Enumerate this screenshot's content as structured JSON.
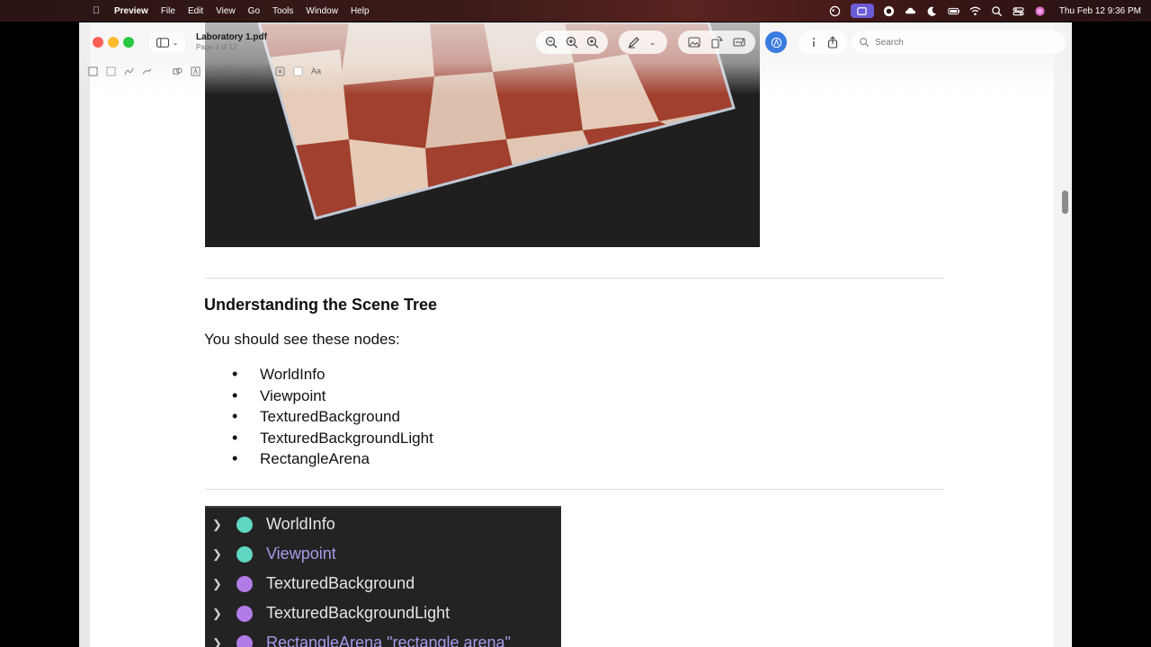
{
  "menubar": {
    "app_name": "Preview",
    "items": [
      "File",
      "Edit",
      "View",
      "Go",
      "Tools",
      "Window",
      "Help"
    ],
    "clock": "Thu Feb 12  9:36 PM"
  },
  "window": {
    "title": "Laboratory 1.pdf",
    "subtitle": "Page 3 of 12",
    "search_placeholder": "Search"
  },
  "document": {
    "heading": "Understanding the Scene Tree",
    "intro": "You should see these nodes:",
    "bullets": [
      "WorldInfo",
      "Viewpoint",
      "TexturedBackground",
      "TexturedBackgroundLight",
      "RectangleArena"
    ],
    "tree_items": [
      {
        "label": "WorldInfo",
        "dot_color": "#5fd6bf",
        "text_color": "#e6e6e6"
      },
      {
        "label": "Viewpoint",
        "dot_color": "#5fd6bf",
        "text_color": "#a59bea"
      },
      {
        "label": "TexturedBackground",
        "dot_color": "#b27be8",
        "text_color": "#e6e6e6"
      },
      {
        "label": "TexturedBackgroundLight",
        "dot_color": "#b27be8",
        "text_color": "#e6e6e6"
      },
      {
        "label": "RectangleArena \"rectangle arena\"",
        "dot_color": "#b27be8",
        "text_color": "#a59bea"
      }
    ]
  },
  "colors": {
    "accent": "#3a7be0",
    "menubar_highlight": "#6a5cd8"
  }
}
